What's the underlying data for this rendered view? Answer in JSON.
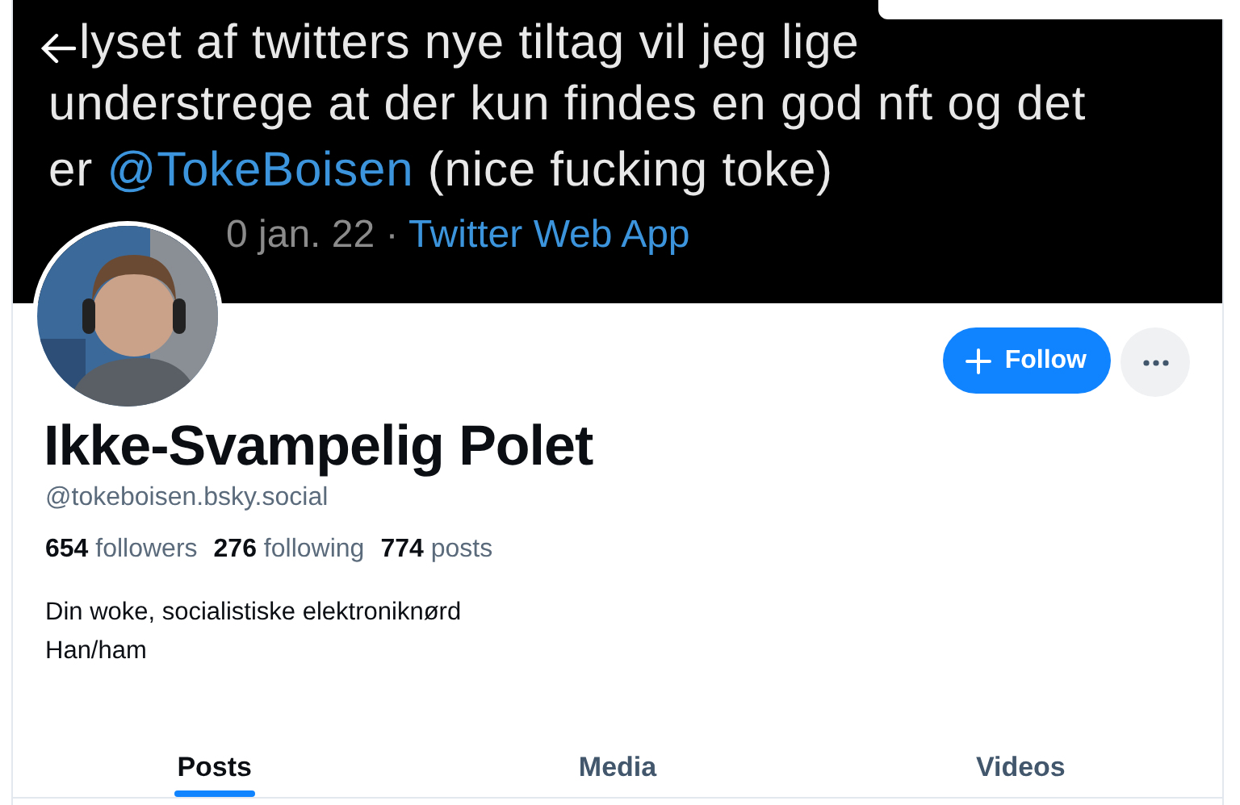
{
  "banner": {
    "lines": [
      [
        {
          "text": "lyset af twitters nye tiltag vil jeg lige",
          "kind": "plain"
        }
      ],
      [
        {
          "text": "understrege at der kun findes en god nft og det",
          "kind": "plain"
        }
      ],
      [
        {
          "text": "er ",
          "kind": "plain"
        },
        {
          "text": "@TokeBoisen",
          "kind": "mention"
        },
        {
          "text": " (nice fucking toke)",
          "kind": "plain"
        }
      ]
    ],
    "meta": [
      {
        "text": "0 jan. 22 · ",
        "kind": "plain"
      },
      {
        "text": "Twitter Web App",
        "kind": "mention"
      }
    ]
  },
  "profile": {
    "name": "Ikke-Svampelig Polet",
    "handle": "@tokeboisen.bsky.social",
    "stats": [
      {
        "count": "654",
        "label": "followers"
      },
      {
        "count": "276",
        "label": "following"
      },
      {
        "count": "774",
        "label": "posts"
      }
    ],
    "bio": [
      "Din woke, socialistiske elektroniknørd",
      "Han/ham"
    ]
  },
  "follow_button": "Follow",
  "tabs": [
    {
      "label": "Posts",
      "selected": true
    },
    {
      "label": "Media",
      "selected": false
    },
    {
      "label": "Videos",
      "selected": false
    }
  ]
}
